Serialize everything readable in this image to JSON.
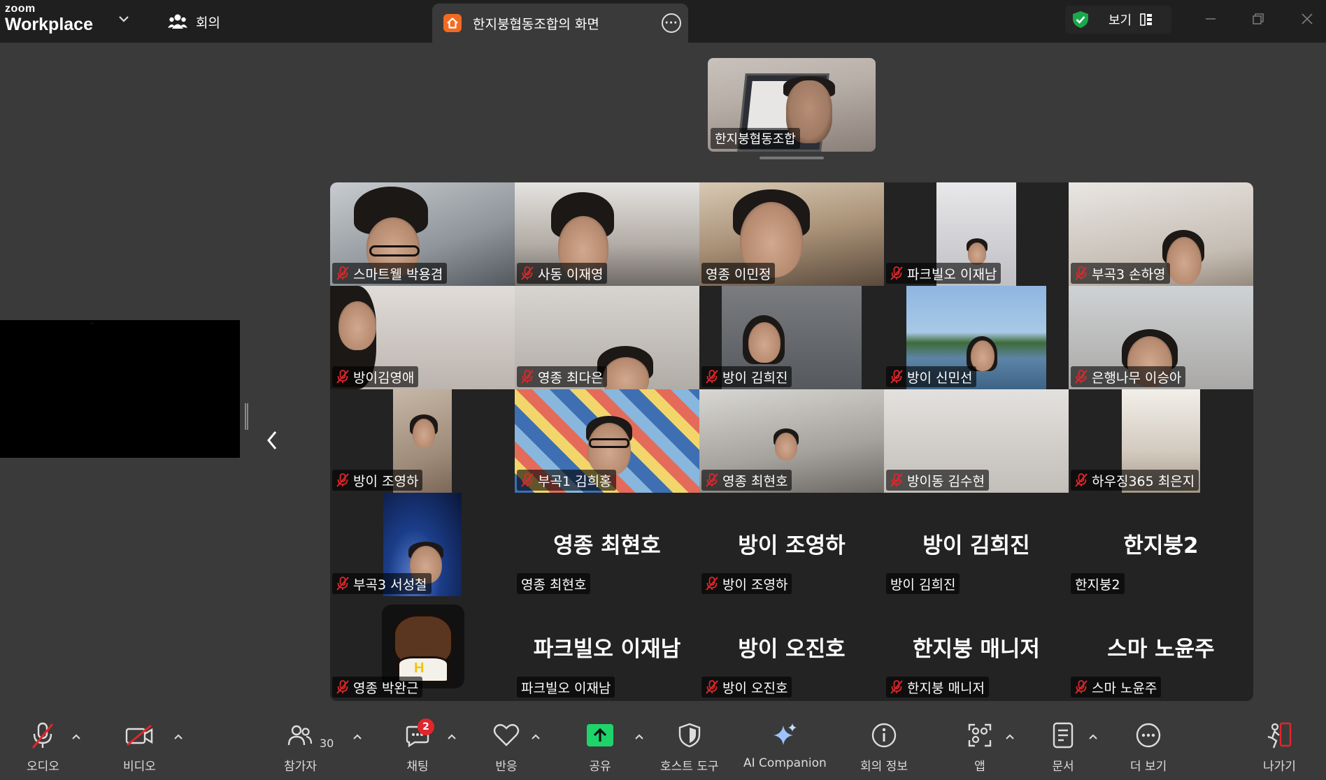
{
  "app": {
    "logo_small": "zoom",
    "logo_big": "Workplace",
    "meeting_label": "회의",
    "share_tab_title": "한지붕협동조합의 화면",
    "view_label": "보기"
  },
  "colors": {
    "titlebar": "#1f1f1f",
    "stage": "#3a3a3a",
    "gallery": "#232323",
    "mute_red": "#e0262b",
    "share_green": "#1fd36b",
    "shield_green": "#19a84b"
  },
  "icons": {
    "meeting": "people-icon",
    "share_tab": "home-icon",
    "more": "more-dots-icon",
    "security": "shield-check-icon",
    "view": "grid-view-icon",
    "mic": "mic-muted-icon",
    "video": "video-off-icon"
  },
  "active_speaker": {
    "name": "한지붕협동조합"
  },
  "screen_share": {
    "caption": "···"
  },
  "participants": [
    {
      "name": "스마트웰 박용겸",
      "muted": true
    },
    {
      "name": "사동 이재영",
      "muted": true
    },
    {
      "name": "영종 이민정",
      "muted": false
    },
    {
      "name": "파크빌오 이재남",
      "muted": true
    },
    {
      "name": "부곡3 손하영",
      "muted": true
    },
    {
      "name": "방이김영애",
      "muted": true
    },
    {
      "name": "영종 최다은",
      "muted": true
    },
    {
      "name": "방이 김희진",
      "muted": true
    },
    {
      "name": "방이 신민선",
      "muted": true
    },
    {
      "name": "은행나무 이승아",
      "muted": true
    },
    {
      "name": "방이 조영하",
      "muted": true
    },
    {
      "name": "부곡1 김희홍",
      "muted": true
    },
    {
      "name": "영종 최현호",
      "muted": true
    },
    {
      "name": "방이동 김수현",
      "muted": true
    },
    {
      "name": "하우징365 최은지",
      "muted": true
    },
    {
      "name": "부곡3 서성철",
      "muted": true
    },
    {
      "name": "영종 최현호",
      "big": "영종 최현호",
      "muted": false
    },
    {
      "name": "방이 조영하",
      "big": "방이 조영하",
      "muted": true
    },
    {
      "name": "방이 김희진",
      "big": "방이 김희진",
      "muted": false
    },
    {
      "name": "한지붕2",
      "big": "한지붕2",
      "muted": false
    },
    {
      "name": "영종 박완근",
      "muted": true
    },
    {
      "name": "파크빌오 이재남",
      "big": "파크빌오 이재남",
      "muted": false
    },
    {
      "name": "방이 오진호",
      "big": "방이 오진호",
      "muted": true
    },
    {
      "name": "한지붕 매니저",
      "big": "한지붕 매니저",
      "muted": true
    },
    {
      "name": "스마 노윤주",
      "big": "스마 노윤주",
      "muted": true
    }
  ],
  "toolbar": {
    "audio": "오디오",
    "video": "비디오",
    "participants": "참가자",
    "participants_count": "30",
    "chat": "채팅",
    "chat_badge": "2",
    "reactions": "반응",
    "share": "공유",
    "host_tools": "호스트 도구",
    "ai": "AI Companion",
    "info": "회의 정보",
    "apps": "앱",
    "docs": "문서",
    "more": "더 보기",
    "leave": "나가기"
  }
}
